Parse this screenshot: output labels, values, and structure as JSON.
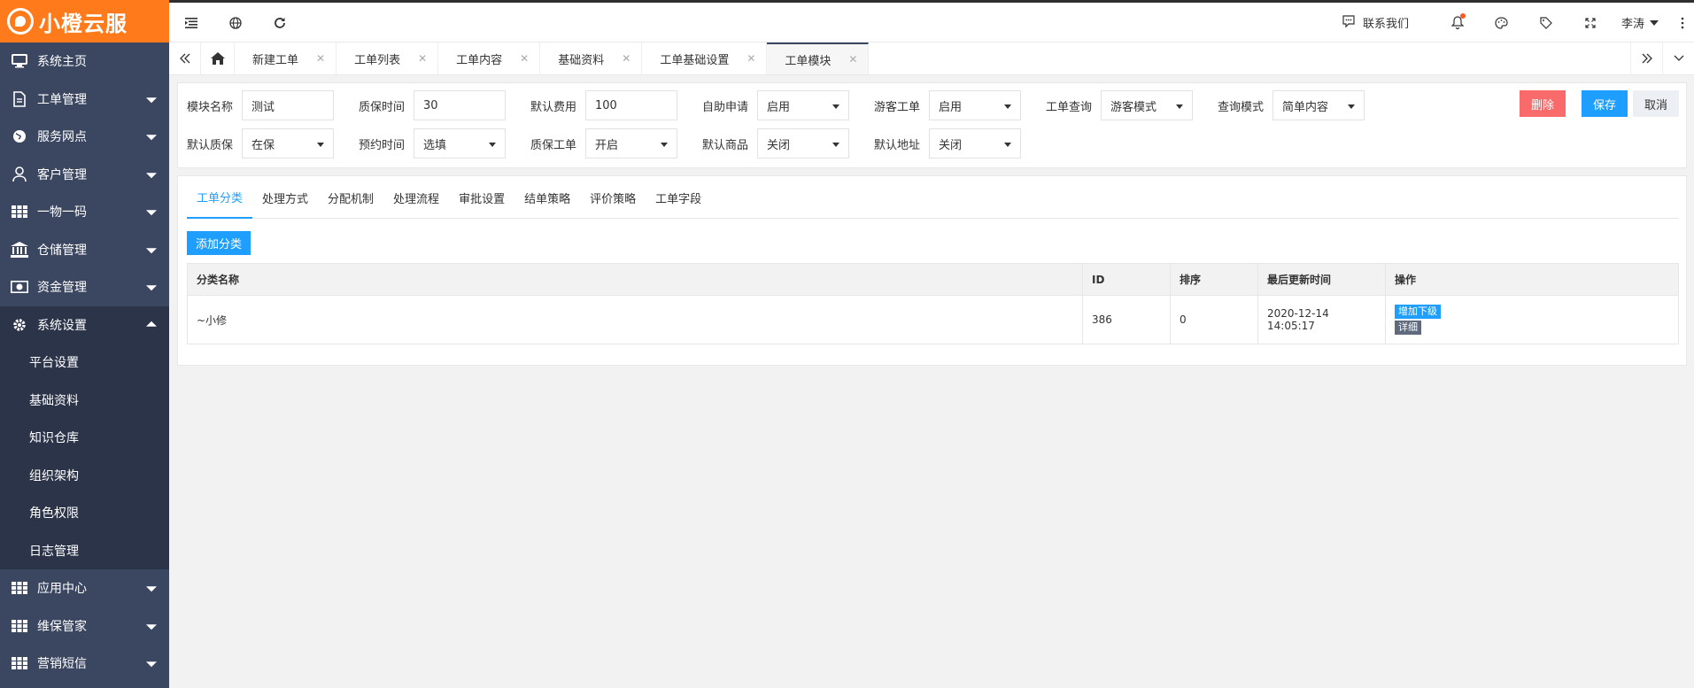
{
  "brand": {
    "name": "小橙云服"
  },
  "colors": {
    "brand_orange": "#ff7a1a",
    "sidebar_bg": "#3b4660",
    "primary_blue": "#1e9fff",
    "danger_red": "#f96b6b"
  },
  "sidebar": {
    "items": [
      {
        "label": "系统主页",
        "icon": "monitor-icon"
      },
      {
        "label": "工单管理",
        "icon": "document-icon"
      },
      {
        "label": "服务网点",
        "icon": "globe-icon"
      },
      {
        "label": "客户管理",
        "icon": "user-icon"
      },
      {
        "label": "一物一码",
        "icon": "grid-icon"
      },
      {
        "label": "仓储管理",
        "icon": "bank-icon"
      },
      {
        "label": "资金管理",
        "icon": "money-icon"
      },
      {
        "label": "系统设置",
        "icon": "gear-icon"
      }
    ],
    "sub_items": [
      {
        "label": "平台设置"
      },
      {
        "label": "基础资料"
      },
      {
        "label": "知识仓库"
      },
      {
        "label": "组织架构"
      },
      {
        "label": "角色权限"
      },
      {
        "label": "日志管理"
      }
    ],
    "bottom_items": [
      {
        "label": "应用中心",
        "icon": "grid-icon"
      },
      {
        "label": "维保管家",
        "icon": "grid-icon"
      },
      {
        "label": "营销短信",
        "icon": "grid-icon"
      }
    ]
  },
  "header": {
    "contact": "联系我们",
    "user": "李涛"
  },
  "tabs": [
    {
      "label": "新建工单"
    },
    {
      "label": "工单列表"
    },
    {
      "label": "工单内容"
    },
    {
      "label": "基础资料"
    },
    {
      "label": "工单基础设置"
    },
    {
      "label": "工单模块"
    }
  ],
  "form": {
    "row1": [
      {
        "label": "模块名称",
        "value": "测试",
        "kind": "input"
      },
      {
        "label": "质保时间",
        "value": "30",
        "kind": "input"
      },
      {
        "label": "默认费用",
        "value": "100",
        "kind": "input"
      },
      {
        "label": "自助申请",
        "value": "启用",
        "kind": "select"
      },
      {
        "label": "游客工单",
        "value": "启用",
        "kind": "select"
      },
      {
        "label": "工单查询",
        "value": "游客模式",
        "kind": "select"
      },
      {
        "label": "查询模式",
        "value": "简单内容",
        "kind": "select"
      }
    ],
    "row2": [
      {
        "label": "默认质保",
        "value": "在保",
        "kind": "select"
      },
      {
        "label": "预约时间",
        "value": "选填",
        "kind": "select"
      },
      {
        "label": "质保工单",
        "value": "开启",
        "kind": "select"
      },
      {
        "label": "默认商品",
        "value": "关闭",
        "kind": "select"
      },
      {
        "label": "默认地址",
        "value": "关闭",
        "kind": "select"
      }
    ],
    "buttons": {
      "delete": "删除",
      "save": "保存",
      "cancel": "取消"
    }
  },
  "subtabs": [
    {
      "label": "工单分类"
    },
    {
      "label": "处理方式"
    },
    {
      "label": "分配机制"
    },
    {
      "label": "处理流程"
    },
    {
      "label": "审批设置"
    },
    {
      "label": "结单策略"
    },
    {
      "label": "评价策略"
    },
    {
      "label": "工单字段"
    }
  ],
  "add_button": "添加分类",
  "table": {
    "headers": [
      "分类名称",
      "ID",
      "排序",
      "最后更新时间",
      "操作"
    ],
    "rows": [
      {
        "name": "~小修",
        "id": "386",
        "order": "0",
        "updated": "2020-12-14 14:05:17",
        "op_add": "增加下级",
        "op_detail": "详细"
      }
    ]
  }
}
